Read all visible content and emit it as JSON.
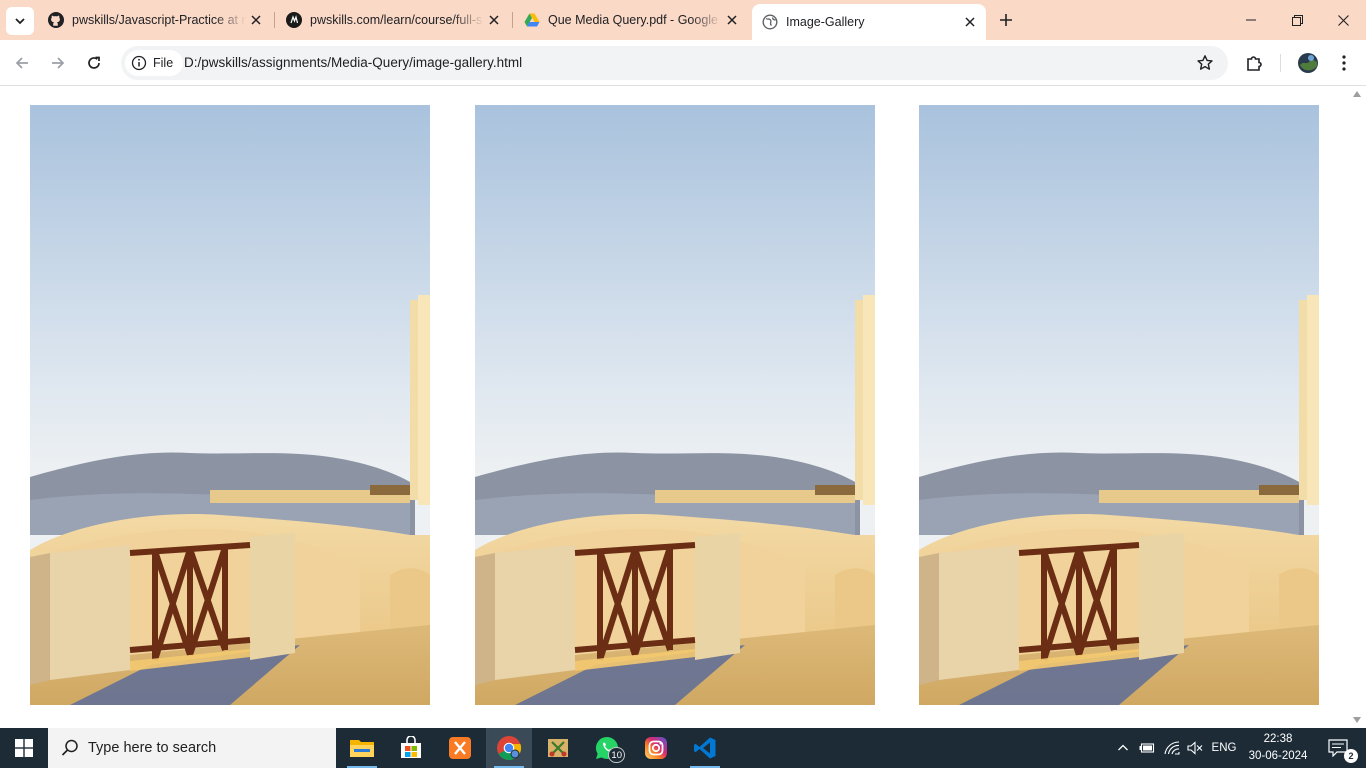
{
  "browser": {
    "tabs": [
      {
        "title": "pwskills/Javascript-Practice at m",
        "favicon": "github-icon",
        "active": false
      },
      {
        "title": "pwskills.com/learn/course/full-s",
        "favicon": "pwskills-icon",
        "active": false
      },
      {
        "title": "Que Media Query.pdf - Google",
        "favicon": "google-drive-icon",
        "active": false
      },
      {
        "title": "Image-Gallery",
        "favicon": "globe-icon",
        "active": true
      }
    ],
    "address_bar": {
      "scheme_chip": "File",
      "url": "D:/pwskills/assignments/Media-Query/image-gallery.html"
    }
  },
  "page": {
    "gallery": {
      "images": [
        {
          "subject": "santorini-balcony-photo"
        },
        {
          "subject": "santorini-balcony-photo"
        },
        {
          "subject": "santorini-balcony-photo"
        }
      ]
    }
  },
  "taskbar": {
    "search_placeholder": "Type here to search",
    "apps": [
      {
        "name": "file-explorer-icon",
        "running": true
      },
      {
        "name": "microsoft-store-icon",
        "running": false
      },
      {
        "name": "xampp-icon",
        "running": false
      },
      {
        "name": "chrome-icon",
        "running": true,
        "active": true
      },
      {
        "name": "snipping-tool-icon",
        "running": false
      },
      {
        "name": "whatsapp-icon",
        "running": false,
        "badge": "10"
      },
      {
        "name": "instagram-icon",
        "running": false
      },
      {
        "name": "vscode-icon",
        "running": true
      }
    ],
    "tray": {
      "language": "ENG",
      "time": "22:38",
      "date": "30-06-2024",
      "notification_count": "2"
    }
  },
  "colors": {
    "tabstrip": "#fbd9c7",
    "taskbar": "#1c2b36",
    "omnibox": "#f1f3f4"
  }
}
